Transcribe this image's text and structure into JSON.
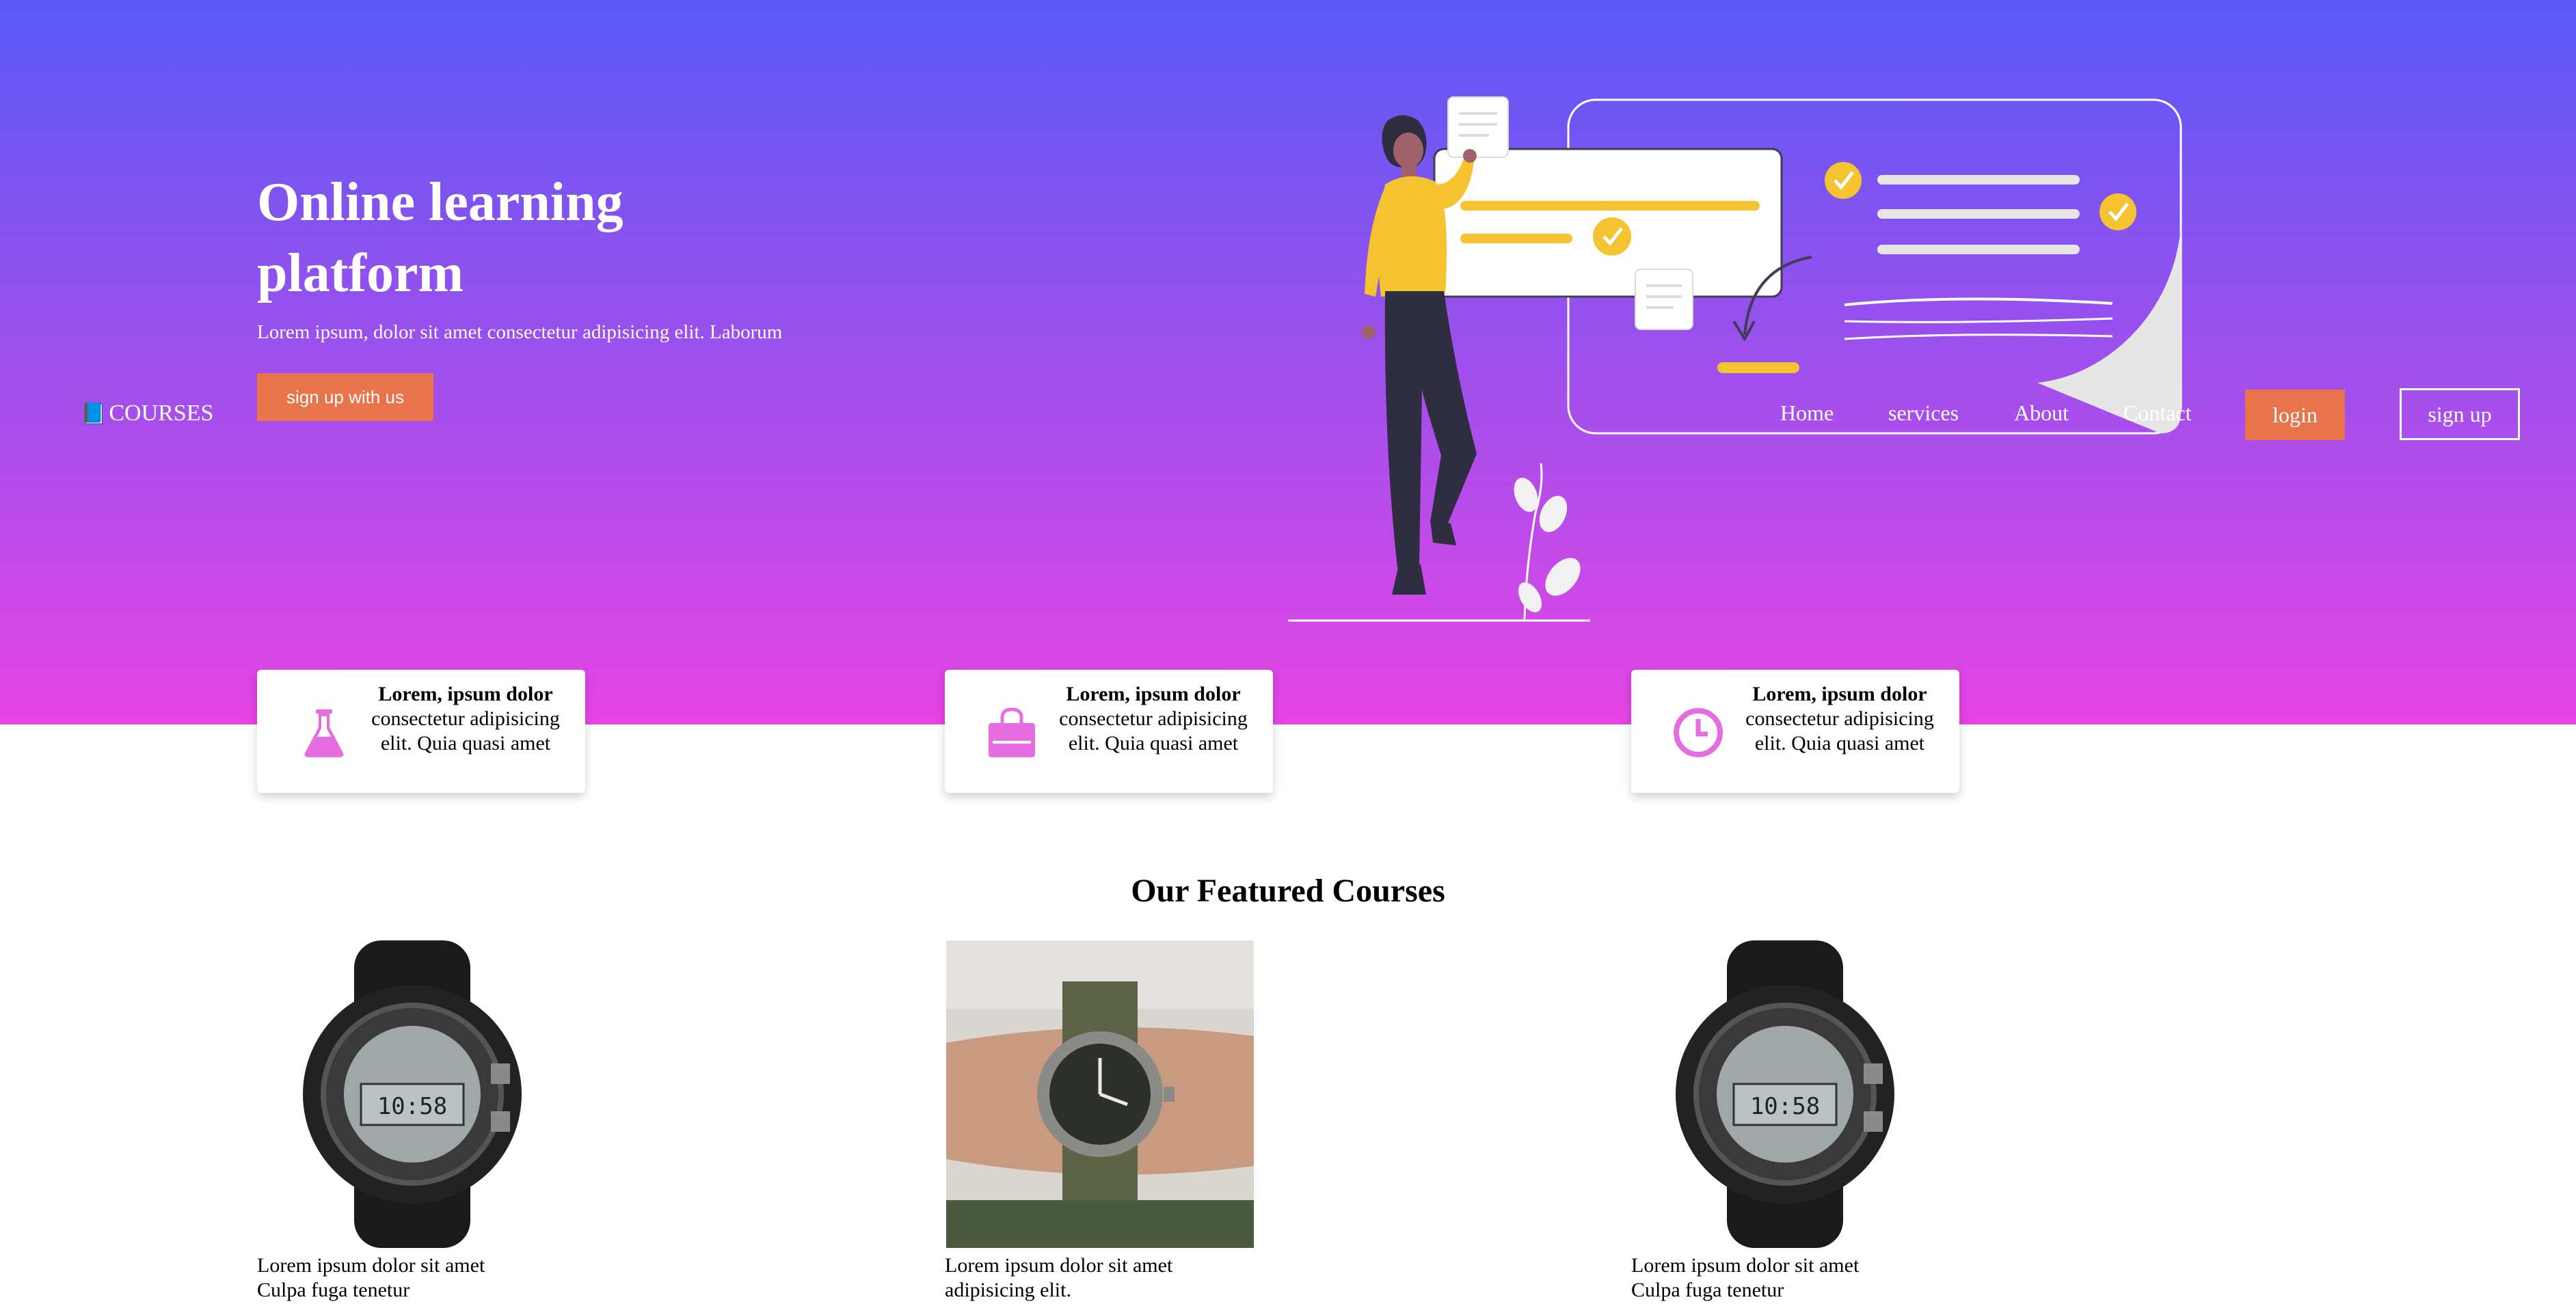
{
  "brand": {
    "name": "COURSES",
    "icon": "book-icon"
  },
  "nav": {
    "links": [
      "Home",
      "services",
      "About",
      "Contact"
    ],
    "login": "login",
    "signup": "sign up"
  },
  "hero": {
    "title": "Online learning platform",
    "subtitle": "Lorem ipsum, dolor sit amet consectetur adipisicing elit. Laborum",
    "cta": "sign up with us"
  },
  "features": [
    {
      "icon": "flask-icon",
      "title": "Lorem, ipsum dolor",
      "text": "consectetur adipisicing elit. Quia quasi amet"
    },
    {
      "icon": "shopping-bag-icon",
      "title": "Lorem, ipsum dolor",
      "text": "consectetur adipisicing elit. Quia quasi amet"
    },
    {
      "icon": "clock-icon",
      "title": "Lorem, ipsum dolor",
      "text": "consectetur adipisicing elit. Quia quasi amet"
    }
  ],
  "featured": {
    "title": "Our Featured Courses",
    "courses": [
      {
        "image": "digital-watch-image",
        "line1": "Lorem ipsum dolor sit amet",
        "line2": "Culpa fuga tenetur"
      },
      {
        "image": "wrist-watch-photo",
        "line1": "Lorem ipsum dolor sit amet",
        "line2": "adipisicing elit."
      },
      {
        "image": "digital-watch-image",
        "line1": "Lorem ipsum dolor sit amet",
        "line2": "Culpa fuga tenetur"
      }
    ]
  },
  "colors": {
    "gradient_top": "#5a5af7",
    "gradient_bottom": "#e744e4",
    "accent": "#e8744b",
    "feature_icon": "#e56de0",
    "illustration_yellow": "#f5c230"
  }
}
